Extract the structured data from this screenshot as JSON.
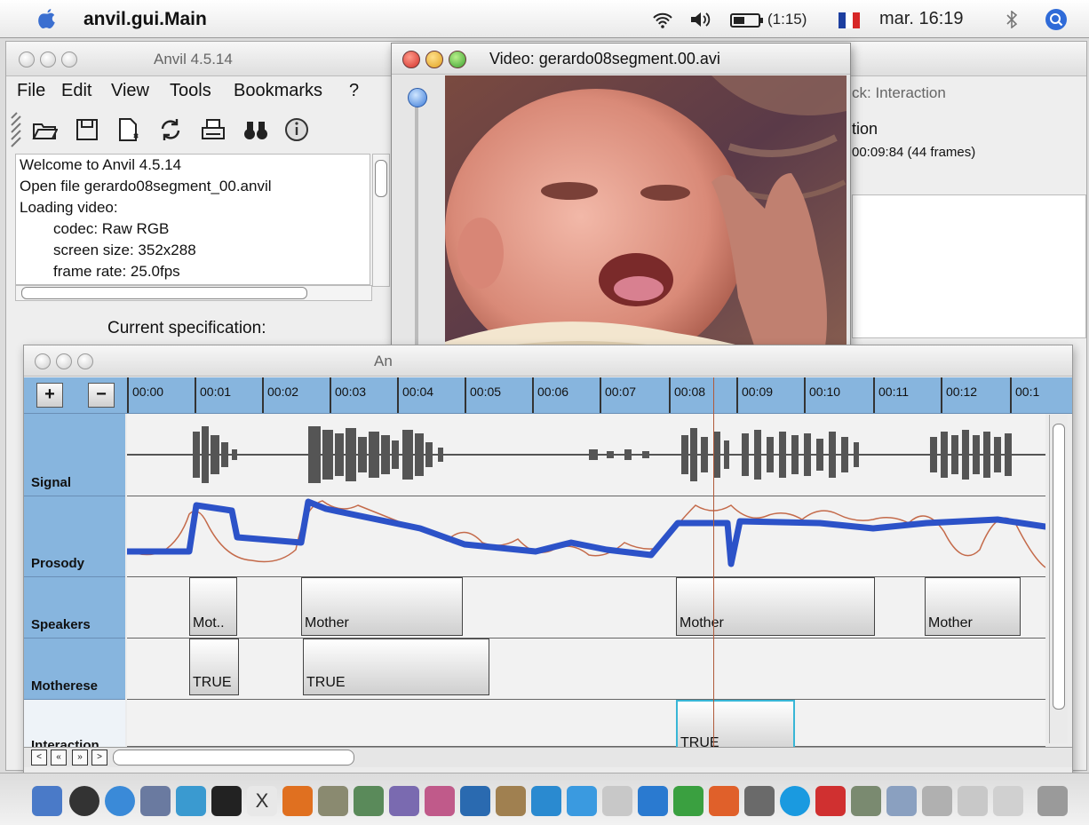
{
  "menubar": {
    "app_name": "anvil.gui.Main",
    "battery": "(1:15)",
    "clock": "mar. 16:19"
  },
  "main_window": {
    "title": "Anvil 4.5.14",
    "menu": [
      "File",
      "Edit",
      "View",
      "Tools",
      "Bookmarks",
      "?"
    ],
    "toolbar_icons": [
      "open-folder-icon",
      "save-icon",
      "new-document-icon",
      "refresh-icon",
      "print-icon",
      "binoculars-icon",
      "info-icon"
    ],
    "log_lines": [
      {
        "text": "Welcome to Anvil 4.5.14",
        "indent": false
      },
      {
        "text": "Open file gerardo08segment_00.anvil",
        "indent": false
      },
      {
        "text": "Loading video:",
        "indent": false
      },
      {
        "text": "codec: Raw RGB",
        "indent": true
      },
      {
        "text": "screen size: 352x288",
        "indent": true
      },
      {
        "text": "frame rate: 25.0fps",
        "indent": true
      }
    ],
    "current_spec_label": "Current specification:",
    "right_panel": {
      "title": "ck: Interaction",
      "heading": "tion",
      "time": "00:09:84 (44 frames)"
    }
  },
  "video_window": {
    "title": "Video: gerardo08segment.00.avi"
  },
  "track_window": {
    "title": "An",
    "timeline_ticks": [
      "00:00",
      "00:01",
      "00:02",
      "00:03",
      "00:04",
      "00:05",
      "00:06",
      "00:07",
      "00:08",
      "00:09",
      "00:10",
      "00:11",
      "00:12",
      "00:1"
    ],
    "tracks": [
      {
        "name": "Signal"
      },
      {
        "name": "Prosody"
      },
      {
        "name": "Speakers"
      },
      {
        "name": "Motherese"
      },
      {
        "name": "Interaction"
      }
    ],
    "speakers_elements": [
      "Mot..",
      "Mother",
      "Mother",
      "Mother"
    ],
    "motherese_elements": [
      "TRUE",
      "TRUE"
    ],
    "interaction_elements": [
      "TRUE"
    ]
  },
  "colors": {
    "track_header": "#87b5de",
    "prosody_blue": "#2c52c8",
    "prosody_thin": "#c46a4a",
    "cursor": "#b05a3a",
    "selected_outline": "#38b6d6"
  }
}
